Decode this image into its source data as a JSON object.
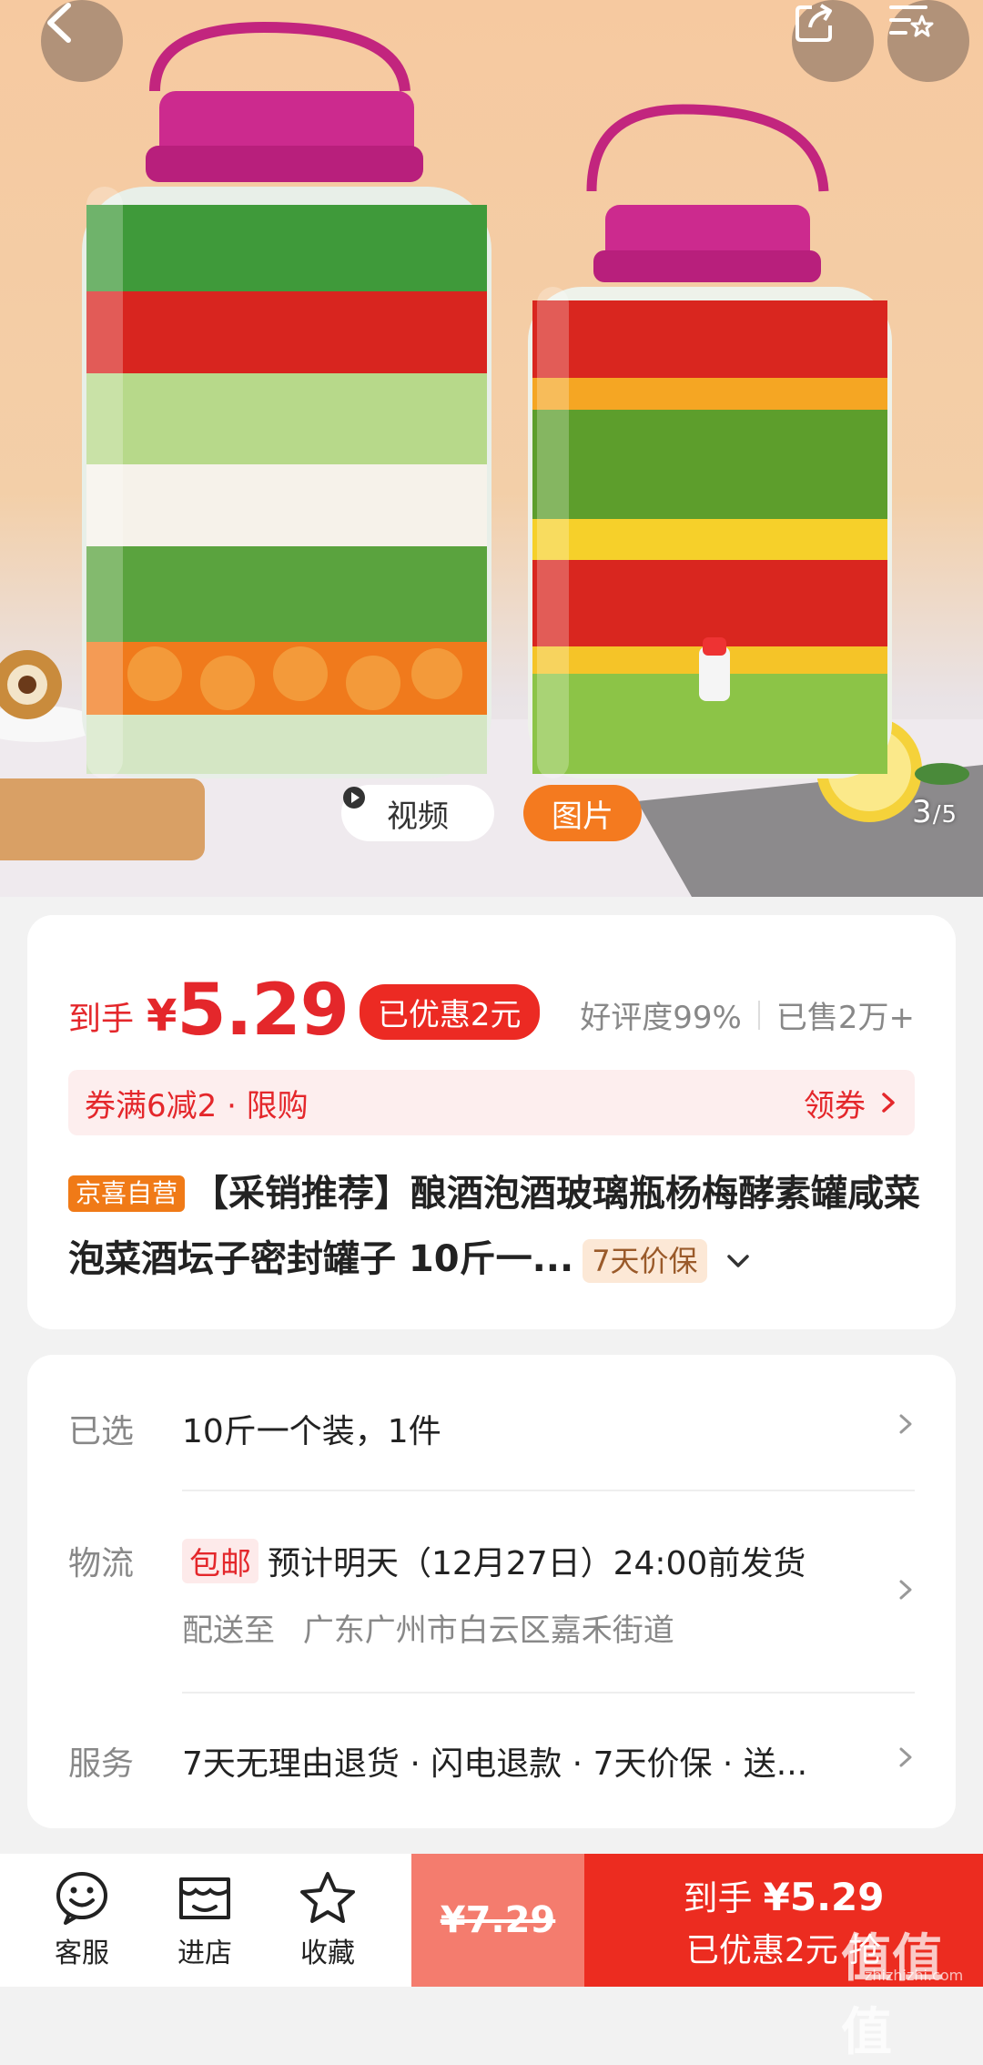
{
  "media": {
    "video_label": "视频",
    "image_label": "图片",
    "counter_current": "3",
    "counter_total": "/5"
  },
  "price": {
    "prefix": "到手",
    "yen": "¥",
    "value": "5.29",
    "discount": "已优惠2元",
    "rating": "好评度99%",
    "sold": "已售2万+"
  },
  "coupon": {
    "text": "券满6减2 · 限购",
    "action": "领券"
  },
  "product": {
    "badge": "京喜自营",
    "title": "【采销推荐】酿酒泡酒玻璃瓶杨梅酵素罐咸菜泡菜酒坛子密封罐子 10斤一...",
    "guarantee": "7天价保"
  },
  "details": {
    "selected_label": "已选",
    "selected_value": "10斤一个装，1件",
    "logistics_label": "物流",
    "free_shipping": "包邮",
    "delivery": "预计明天（12月27日）24:00前发货",
    "ship_to_label": "配送至",
    "ship_to": "广东广州市白云区嘉禾街道",
    "service_label": "服务",
    "service_value": "7天无理由退货 · 闪电退款 · 7天价保 · 送..."
  },
  "bottom": {
    "service": "客服",
    "store": "进店",
    "favorite": "收藏",
    "original_price": "¥7.29",
    "buy_line1_prefix": "到手",
    "buy_line1_price": "¥5.29",
    "buy_line2": "已优惠2元 抢"
  },
  "watermark": {
    "text": "值值值",
    "url": "zhizhizhi.com"
  },
  "colors": {
    "accent_red": "#e4272b",
    "buy_button": "#ec2c20",
    "original_button": "#f47c6e",
    "self_badge": "#f07a17"
  }
}
